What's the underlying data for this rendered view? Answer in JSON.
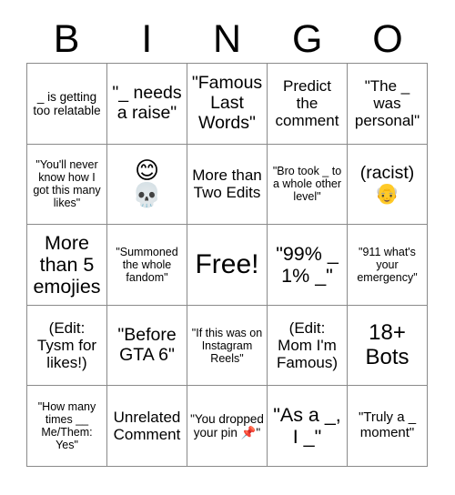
{
  "card": {
    "header_letters": [
      "B",
      "I",
      "N",
      "G",
      "O"
    ],
    "grid_columns": 5,
    "grid_rows": 5,
    "border_color": "#8a8a8a",
    "text_color": "#000000",
    "background_color": "#ffffff",
    "cells": [
      {
        "id": "b1",
        "text": "_ is getting too relatable",
        "emoji": ""
      },
      {
        "id": "i1",
        "text": "\"_ needs a raise\"",
        "emoji": ""
      },
      {
        "id": "n1",
        "text": "\"Famous Last Words\"",
        "emoji": ""
      },
      {
        "id": "g1",
        "text": "Predict the comment",
        "emoji": ""
      },
      {
        "id": "o1",
        "text": "\"The _ was personal\"",
        "emoji": ""
      },
      {
        "id": "b2",
        "text": "\"You'll never know how I got this many likes\"",
        "emoji": ""
      },
      {
        "id": "i2",
        "text": "",
        "emoji": "😊\n💀"
      },
      {
        "id": "n2",
        "text": "More than Two Edits",
        "emoji": ""
      },
      {
        "id": "g2",
        "text": "\"Bro took _ to a whole other level\"",
        "emoji": ""
      },
      {
        "id": "o2",
        "text": "(racist)",
        "emoji": "👴"
      },
      {
        "id": "b3",
        "text": "More than 5 emojies",
        "emoji": ""
      },
      {
        "id": "i3",
        "text": "\"Summoned the whole fandom\"",
        "emoji": ""
      },
      {
        "id": "n3",
        "text": "Free!",
        "emoji": ""
      },
      {
        "id": "g3",
        "text": "\"99% _ 1% _\"",
        "emoji": ""
      },
      {
        "id": "o3",
        "text": "\"911 what's your emergency\"",
        "emoji": ""
      },
      {
        "id": "b4",
        "text": "(Edit: Tysm for likes!)",
        "emoji": ""
      },
      {
        "id": "i4",
        "text": "\"Before GTA 6\"",
        "emoji": ""
      },
      {
        "id": "n4",
        "text": "\"If this was on Instagram Reels\"",
        "emoji": ""
      },
      {
        "id": "g4",
        "text": "(Edit: Mom I'm Famous)",
        "emoji": ""
      },
      {
        "id": "o4",
        "text": "18+ Bots",
        "emoji": ""
      },
      {
        "id": "b5",
        "text": "\"How many times __ Me/Them: Yes\"",
        "emoji": ""
      },
      {
        "id": "i5",
        "text": "Unrelated Comment",
        "emoji": ""
      },
      {
        "id": "n5",
        "text": "\"You dropped your pin 📌\"",
        "emoji": ""
      },
      {
        "id": "g5",
        "text": "\"As a _, I _\"",
        "emoji": ""
      },
      {
        "id": "o5",
        "text": "\"Truly a _ moment\"",
        "emoji": ""
      }
    ]
  }
}
